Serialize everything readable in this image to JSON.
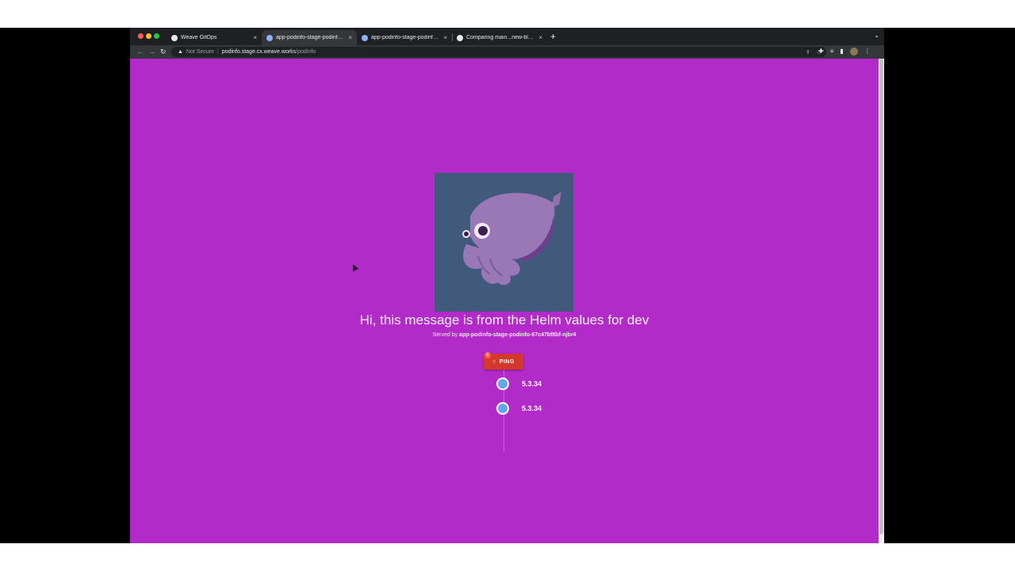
{
  "browser": {
    "tabs": [
      {
        "title": "Weave GitOps",
        "icon": "weave-favicon",
        "active": false
      },
      {
        "title": "app-podinfo-stage-podinfo-67",
        "icon": "podinfo-favicon",
        "active": true
      },
      {
        "title": "app-podinfo-stage-podinfo-67",
        "icon": "podinfo-favicon",
        "active": false
      },
      {
        "title": "Comparing main...new-blue-co",
        "icon": "github-favicon",
        "active": false
      }
    ],
    "close_glyph": "×",
    "new_tab_glyph": "+",
    "tab_menu_glyph": "⌄",
    "address": {
      "security_label": "Not Secure",
      "host": "podinfo.stage.cx.weave.works",
      "path": "/podinfo"
    }
  },
  "page": {
    "background": "#b22ac7",
    "message": "Hi, this message is from the Helm values for dev",
    "served_by_prefix": "Served by",
    "served_by_pod": "app-podinfo-stage-podinfo-67c47bf8bf-njbr4",
    "ping_label": "PING",
    "ping_badge": "0",
    "versions": [
      "5.3.34",
      "5.3.34"
    ]
  },
  "colors": {
    "ping_button": "#d4382d",
    "timeline_dot": "#64a4ef",
    "logo_background": "#415a7c"
  }
}
